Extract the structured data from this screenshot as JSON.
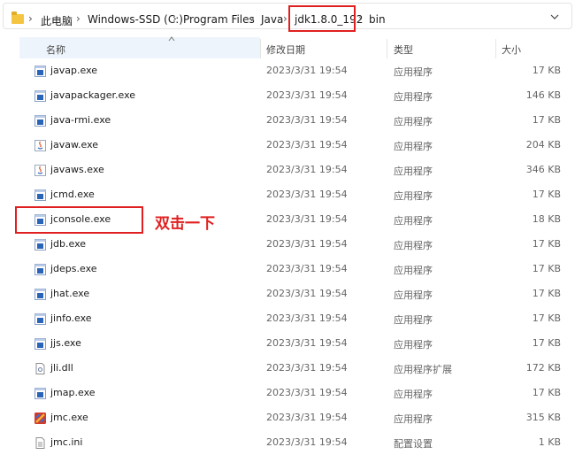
{
  "breadcrumb": {
    "items": [
      "此电脑",
      "Windows-SSD (C:)",
      "Program Files",
      "Java",
      "jdk1.8.0_192",
      "bin"
    ],
    "separator": "›"
  },
  "columns": {
    "name": "名称",
    "date": "修改日期",
    "type": "类型",
    "size": "大小"
  },
  "files": [
    {
      "name": "javap.exe",
      "date": "2023/3/31 19:54",
      "type": "应用程序",
      "size": "17 KB",
      "icon": "exe-icon"
    },
    {
      "name": "javapackager.exe",
      "date": "2023/3/31 19:54",
      "type": "应用程序",
      "size": "146 KB",
      "icon": "exe-icon"
    },
    {
      "name": "java-rmi.exe",
      "date": "2023/3/31 19:54",
      "type": "应用程序",
      "size": "17 KB",
      "icon": "exe-icon"
    },
    {
      "name": "javaw.exe",
      "date": "2023/3/31 19:54",
      "type": "应用程序",
      "size": "204 KB",
      "icon": "java-exe-icon"
    },
    {
      "name": "javaws.exe",
      "date": "2023/3/31 19:54",
      "type": "应用程序",
      "size": "346 KB",
      "icon": "java-exe-icon"
    },
    {
      "name": "jcmd.exe",
      "date": "2023/3/31 19:54",
      "type": "应用程序",
      "size": "17 KB",
      "icon": "exe-icon"
    },
    {
      "name": "jconsole.exe",
      "date": "2023/3/31 19:54",
      "type": "应用程序",
      "size": "18 KB",
      "icon": "exe-icon"
    },
    {
      "name": "jdb.exe",
      "date": "2023/3/31 19:54",
      "type": "应用程序",
      "size": "17 KB",
      "icon": "exe-icon"
    },
    {
      "name": "jdeps.exe",
      "date": "2023/3/31 19:54",
      "type": "应用程序",
      "size": "17 KB",
      "icon": "exe-icon"
    },
    {
      "name": "jhat.exe",
      "date": "2023/3/31 19:54",
      "type": "应用程序",
      "size": "17 KB",
      "icon": "exe-icon"
    },
    {
      "name": "jinfo.exe",
      "date": "2023/3/31 19:54",
      "type": "应用程序",
      "size": "17 KB",
      "icon": "exe-icon"
    },
    {
      "name": "jjs.exe",
      "date": "2023/3/31 19:54",
      "type": "应用程序",
      "size": "17 KB",
      "icon": "exe-icon"
    },
    {
      "name": "jli.dll",
      "date": "2023/3/31 19:54",
      "type": "应用程序扩展",
      "size": "172 KB",
      "icon": "dll-icon"
    },
    {
      "name": "jmap.exe",
      "date": "2023/3/31 19:54",
      "type": "应用程序",
      "size": "17 KB",
      "icon": "exe-icon"
    },
    {
      "name": "jmc.exe",
      "date": "2023/3/31 19:54",
      "type": "应用程序",
      "size": "315 KB",
      "icon": "jmc-icon"
    },
    {
      "name": "jmc.ini",
      "date": "2023/3/31 19:54",
      "type": "配置设置",
      "size": "1 KB",
      "icon": "ini-icon"
    }
  ],
  "annotation": "双击一下",
  "colors": {
    "highlight": "#e02020",
    "exe_icon_blue": "#2a64b8",
    "header_bg": "#eef4fb"
  }
}
